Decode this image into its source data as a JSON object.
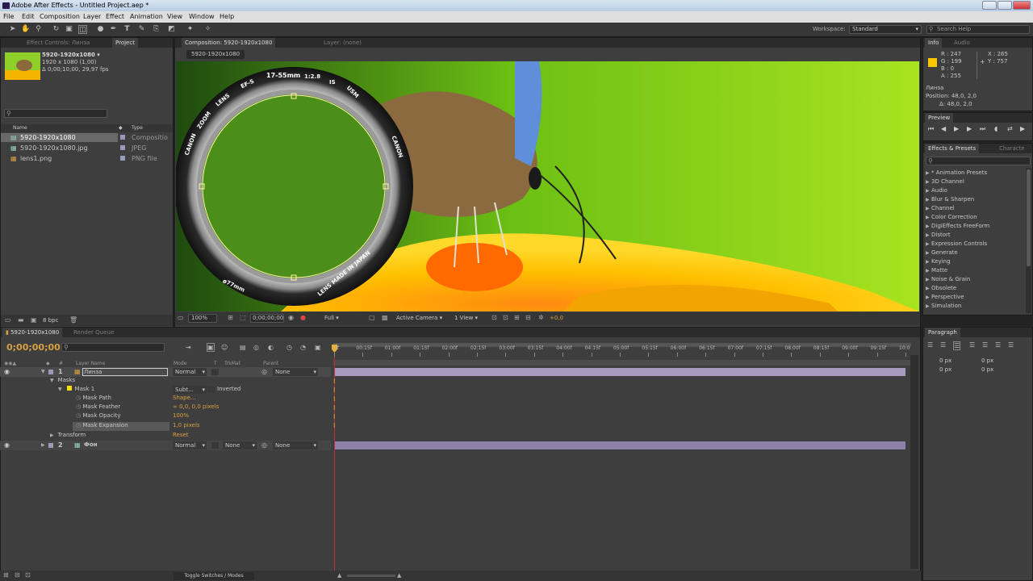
{
  "title": "Adobe After Effects - Untitled Project.aep *",
  "menu": [
    "File",
    "Edit",
    "Composition",
    "Layer",
    "Effect",
    "Animation",
    "View",
    "Window",
    "Help"
  ],
  "workspace": {
    "label": "Workspace:",
    "value": "Standard"
  },
  "search_help": "Search Help",
  "project": {
    "tabs": [
      "Effect Controls: Линза",
      "Project"
    ],
    "item_name": "5920-1920x1080 ▾",
    "item_res": "1920 x 1080 (1,00)",
    "item_dur": "Δ 0;00;10;00, 29,97 fps",
    "columns": {
      "name": "Name",
      "type": "Type"
    },
    "items": [
      {
        "name": "5920-1920x1080",
        "type": "Compositio"
      },
      {
        "name": "5920-1920x1080.jpg",
        "type": "JPEG"
      },
      {
        "name": "lens1.png",
        "type": "PNG file"
      }
    ],
    "bpc": "8 bpc"
  },
  "composition": {
    "tab": "Composition: 5920-1920x1080",
    "layer_tab": "Layer: (none)",
    "comp_name": "5920-1920x1080",
    "lens_text": [
      "17-55mm",
      "1:2.8",
      "IS",
      "USM",
      "EF-S",
      "LENS",
      "ZOOM",
      "CANON",
      "CANON",
      "LENS MADE IN JAPAN",
      "ø77mm"
    ],
    "zoom": "100%",
    "time": "0;00;00;00",
    "resolution": "Full",
    "camera": "Active Camera",
    "views": "1 View",
    "exposure": "+0,0"
  },
  "info": {
    "tabs": [
      "Info",
      "Audio"
    ],
    "r": "R : 247",
    "g": "G : 199",
    "b": "B : 0",
    "a": "A : 255",
    "x": "X : 265",
    "y": "Y : 757",
    "layer": "Линза",
    "position": "Position: 48,0, 2,0",
    "delta": "Δ: 48,0, 2,0",
    "swatch": "#f7c700"
  },
  "preview": {
    "tab": "Preview"
  },
  "effects": {
    "tabs": [
      "Effects & Presets",
      "Characte"
    ],
    "items": [
      "* Animation Presets",
      "3D Channel",
      "Audio",
      "Blur & Sharpen",
      "Channel",
      "Color Correction",
      "DigiEffects FreeForm",
      "Distort",
      "Expression Controls",
      "Generate",
      "Keying",
      "Matte",
      "Noise & Grain",
      "Obsolete",
      "Perspective",
      "Simulation"
    ]
  },
  "paragraph": {
    "tab": "Paragraph",
    "px": [
      "0 px",
      "0 px",
      "0 px",
      "0 px",
      "0 px"
    ]
  },
  "timeline": {
    "tabs": [
      "5920-1920x1080",
      "Render Queue"
    ],
    "timecode": "0;00;00;00",
    "columns": {
      "layer": "Layer Name",
      "mode": "Mode",
      "t": "T",
      "trkmat": "TrkMat",
      "parent": "Parent"
    },
    "ruler": [
      "0f",
      "00:15f",
      "01:00f",
      "01:15f",
      "02:00f",
      "02:15f",
      "03:00f",
      "03:15f",
      "04:00f",
      "04:15f",
      "05:00f",
      "05:15f",
      "06:00f",
      "06:15f",
      "07:00f",
      "07:15f",
      "08:00f",
      "08:15f",
      "09:00f",
      "09:15f",
      "10:0"
    ],
    "layer1": {
      "num": "1",
      "name": "Линза",
      "mode": "Normal",
      "parent": "None"
    },
    "masks": "Masks",
    "mask1": {
      "name": "Mask 1",
      "mode": "Subt...",
      "inverted": "Inverted"
    },
    "props": [
      {
        "name": "Mask Path",
        "value": "Shape..."
      },
      {
        "name": "Mask Feather",
        "value": "0,0, 0,0 pixels"
      },
      {
        "name": "Mask Opacity",
        "value": "100%"
      },
      {
        "name": "Mask Expansion",
        "value": "1,0 pixels"
      }
    ],
    "transform": {
      "name": "Transform",
      "value": "Reset"
    },
    "layer2": {
      "num": "2",
      "name": "Фон",
      "mode": "Normal",
      "trkmat": "None",
      "parent": "None"
    },
    "toggle": "Toggle Switches / Modes"
  }
}
